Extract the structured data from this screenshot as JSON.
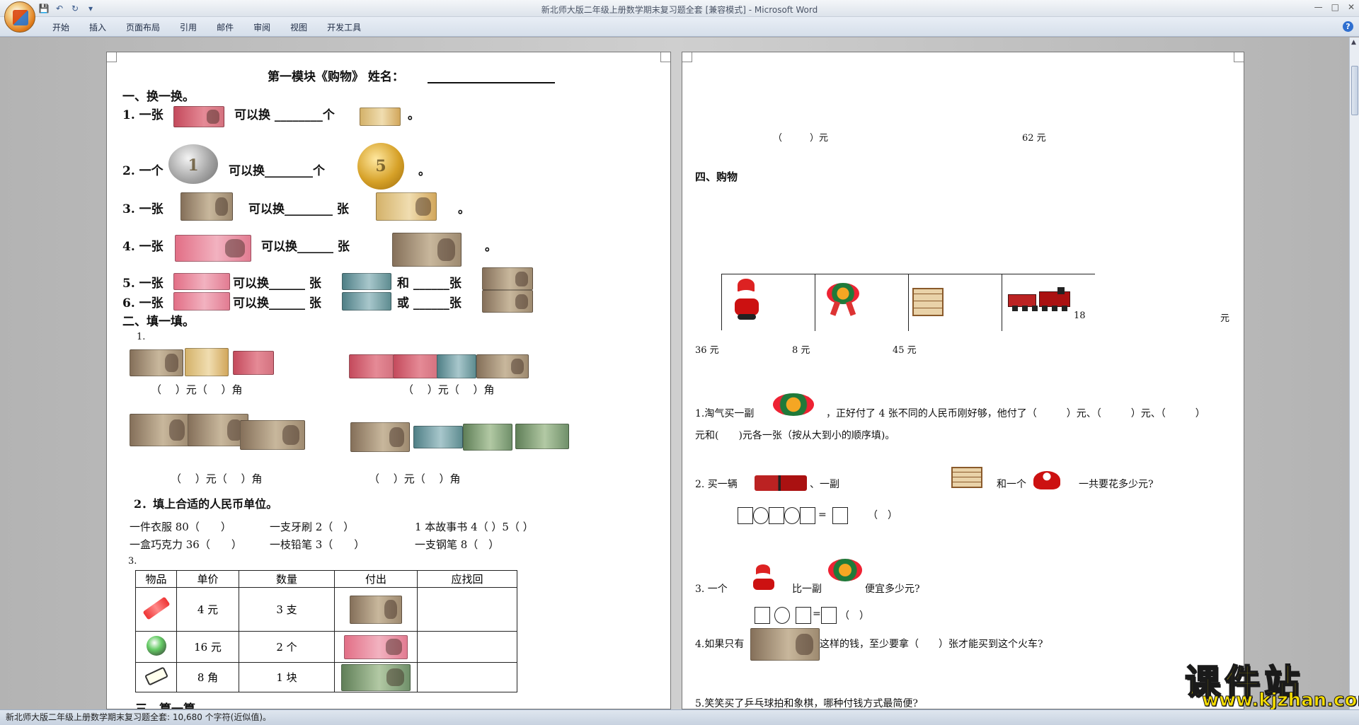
{
  "window": {
    "title": "新北师大版二年级上册数学期末复习题全套 [兼容模式] - Microsoft Word",
    "controls": [
      "—",
      "□",
      "✕"
    ]
  },
  "quick_access": {
    "save_icon": "💾",
    "undo_icon": "↶",
    "redo_icon": "↻",
    "more_icon": "▾"
  },
  "ribbon": {
    "tabs": [
      "开始",
      "插入",
      "页面布局",
      "引用",
      "邮件",
      "审阅",
      "视图",
      "开发工具"
    ],
    "help": "?"
  },
  "status_bar": {
    "text": "新北师大版二年级上册数学期末复习题全套: 10,680 个字符(近似值)。"
  },
  "watermark": {
    "line1": "课件站",
    "line2": "www.kjzhan.com"
  },
  "page1": {
    "title": "第一模块《购物》 姓名：",
    "sec1": "一、换一换。",
    "q1a": "1. 一张",
    "q1b": "可以换 ________个",
    "q1c": "。",
    "q2a": "2. 一个",
    "q2b": "可以换________个",
    "q2c": "。",
    "q3a": "3. 一张",
    "q3b": "可以换________ 张",
    "q3c": "。",
    "q4a": "4. 一张",
    "q4b": "可以换______ 张",
    "q4c": "。",
    "q5a": "5. 一张",
    "q5b": "可以换______ 张",
    "q5c": "和 ______张",
    "q6a": "6. 一张",
    "q6b": "可以换______ 张",
    "q6c": "或 ______张",
    "sec2": "二、填一填。",
    "f1": "1.",
    "yuanjiao": "（　 ）元（　 ）角",
    "yuanjiao2": "（　 ）元（　 ）角",
    "f2": "2．填上合适的人民币单位。",
    "u1": "一件衣服 80（　　）",
    "u2": "一支牙刷 2（　）",
    "u3": "1 本故事书 4（ ）5（ ）",
    "u4": "一盒巧克力 36（　　）",
    "u5": "一枝铅笔 3（　　）",
    "u6": "一支钢笔 8（　）",
    "f3": "3.",
    "table": {
      "headers": [
        "物品",
        "单价",
        "数量",
        "付出",
        "应找回"
      ],
      "rows": [
        [
          "4 元",
          "3 支"
        ],
        [
          "16 元",
          "2 个"
        ],
        [
          "8 角",
          "1 块"
        ]
      ]
    },
    "sec3": "三、算一算。"
  },
  "page2": {
    "blank_yuan": "（　　　）元",
    "val62": "62 元",
    "sec4": "四、购物",
    "price18": "18",
    "yuan": "元",
    "prices": [
      "36 元",
      "8 元",
      "45 元"
    ],
    "p1a": "1.淘气买一副",
    "p1b": "，正好付了 4 张不同的人民币刚好够，他付了（　　　）元、（　　　）元、（　　　）",
    "p1c": "元和(　　)元各一张（按从大到小的顺序填)。",
    "p2a": "2.  买一辆",
    "p2b": "、一副",
    "p2c": "和一个",
    "p2d": "一共要花多少元?",
    "eq_end": "（　）",
    "p3a": "3.  一个",
    "p3b": "比一副",
    "p3c": "便宜多少元?",
    "p3_end": "（　）",
    "p4a": "4.如果只有",
    "p4b": "这样的钱，至少要拿（　　）张才能买到这个火车?",
    "p5": "5.笑笑买了乒乓球拍和象棋，哪种付钱方式最简便?"
  }
}
